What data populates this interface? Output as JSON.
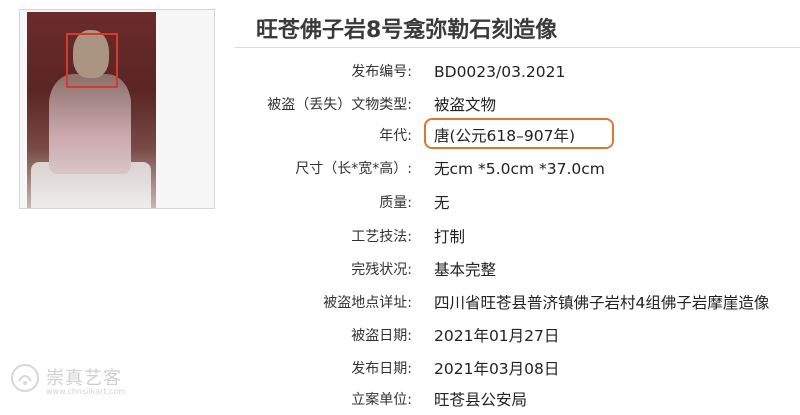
{
  "title": "旺苍佛子岩8号龛弥勒石刻造像",
  "fields": [
    {
      "label": "发布编号:",
      "value": "BD0023/03.2021"
    },
    {
      "label": "被盗（丢失）文物类型:",
      "value": "被盗文物"
    },
    {
      "label": "年代:",
      "value": "唐(公元618–907年)"
    },
    {
      "label": "尺寸（长*宽*高）:",
      "value": "无cm *5.0cm *37.0cm"
    },
    {
      "label": "质量:",
      "value": "无"
    },
    {
      "label": "工艺技法:",
      "value": "打制"
    },
    {
      "label": "完残状况:",
      "value": "基本完整"
    },
    {
      "label": "被盗地点详址:",
      "value": "四川省旺苍县普济镇佛子岩村4组佛子岩摩崖造像"
    },
    {
      "label": "被盗日期:",
      "value": "2021年01月27日"
    },
    {
      "label": "发布日期:",
      "value": "2021年03月08日"
    },
    {
      "label": "立案单位:",
      "value": "旺苍县公安局"
    }
  ],
  "watermark": {
    "name": "崇真艺客",
    "url": "www.chnsilkart.com"
  },
  "colors": {
    "highlight": "#e2742b",
    "face_box": "#d43b2d"
  }
}
